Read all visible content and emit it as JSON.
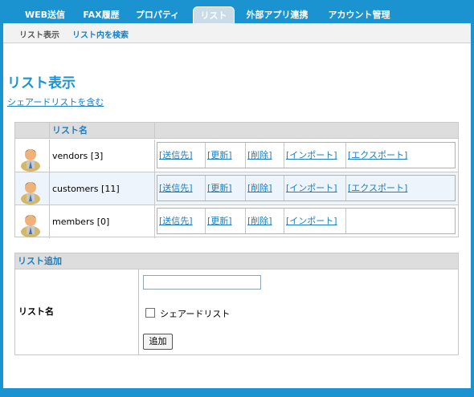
{
  "nav": {
    "tabs": [
      {
        "label": "WEB送信"
      },
      {
        "label": "FAX履歴"
      },
      {
        "label": "プロパティ"
      },
      {
        "label": "リスト"
      },
      {
        "label": "外部アプリ連携"
      },
      {
        "label": "アカウント管理"
      }
    ],
    "active_tab": "リスト"
  },
  "subnav": {
    "items": [
      {
        "label": "リスト表示"
      },
      {
        "label": "リスト内を検索"
      }
    ]
  },
  "page": {
    "title": "リスト表示",
    "share_link": "シェアードリストを含む"
  },
  "list_table": {
    "header_name": "リスト名",
    "rows": [
      {
        "name": "vendors [3]",
        "actions": [
          "[送信先]",
          "[更新]",
          "[削除]",
          "[インポート]",
          "[エクスポート]"
        ]
      },
      {
        "name": "customers [11]",
        "actions": [
          "[送信先]",
          "[更新]",
          "[削除]",
          "[インポート]",
          "[エクスポート]"
        ]
      },
      {
        "name": "members [0]",
        "actions": [
          "[送信先]",
          "[更新]",
          "[削除]",
          "[インポート]"
        ]
      }
    ]
  },
  "add_form": {
    "header": "リスト追加",
    "label": "リスト名",
    "name_value": "",
    "shared_label": "シェアードリスト",
    "submit_label": "追加"
  },
  "colors": {
    "brand": "#1b93d1",
    "link": "#1b7fbf",
    "header_bg": "#dddddd",
    "alt_row": "#eef4fb"
  }
}
